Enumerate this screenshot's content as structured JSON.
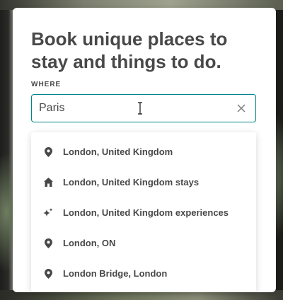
{
  "card": {
    "headline": "Book unique places to stay and things to do.",
    "where_label": "WHERE"
  },
  "search": {
    "value": "Paris",
    "clear_icon": "close-icon",
    "cursor_icon": "text-cursor-icon",
    "accent_color": "#008489"
  },
  "suggestions": [
    {
      "label": "London, United Kingdom",
      "icon": "location-pin-icon"
    },
    {
      "label": "London, United Kingdom stays",
      "icon": "home-icon"
    },
    {
      "label": "London, United Kingdom experiences",
      "icon": "sparkle-icon"
    },
    {
      "label": "London, ON",
      "icon": "location-pin-icon"
    },
    {
      "label": "London Bridge, London",
      "icon": "location-pin-icon"
    }
  ]
}
